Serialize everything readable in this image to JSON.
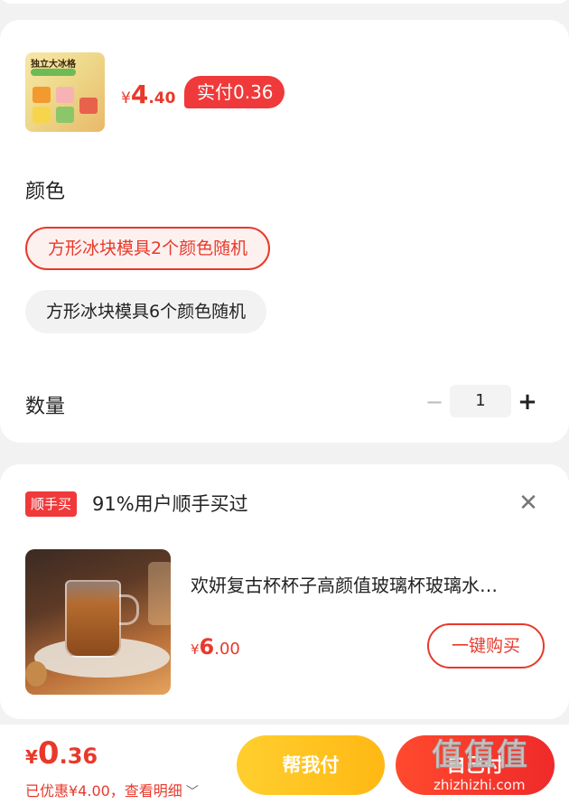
{
  "product": {
    "thumb_label": "独立大冰格",
    "price_symbol": "¥",
    "price_int": "4",
    "price_dec": ".40",
    "pay_tag": "实付0.36"
  },
  "color_section": {
    "label": "颜色",
    "options": [
      {
        "label": "方形冰块模具2个颜色随机",
        "selected": true
      },
      {
        "label": "方形冰块模具6个颜色随机",
        "selected": false
      }
    ]
  },
  "quantity": {
    "label": "数量",
    "minus": "−",
    "value": "1",
    "plus": "+"
  },
  "addon": {
    "badge": "顺手买",
    "title": "91%用户顺手买过",
    "close": "✕",
    "item": {
      "title": "欢妍复古杯杯子高颜值玻璃杯玻璃水…",
      "price_symbol": "¥",
      "price_int": "6",
      "price_dec": ".00",
      "button": "一键购买"
    }
  },
  "footer": {
    "price_symbol": "¥",
    "price_int": "0",
    "price_dec": ".36",
    "discount": "已优惠¥4.00，查看明细",
    "chevron": "﹀",
    "help_button": "帮我付",
    "self_button": "自己付"
  },
  "watermark": {
    "chars": "值值值",
    "url": "zhizhizhi.com"
  },
  "colors": {
    "accent": "#e8392b",
    "help_btn": "#ffc21f",
    "background": "#f2f2f2"
  }
}
